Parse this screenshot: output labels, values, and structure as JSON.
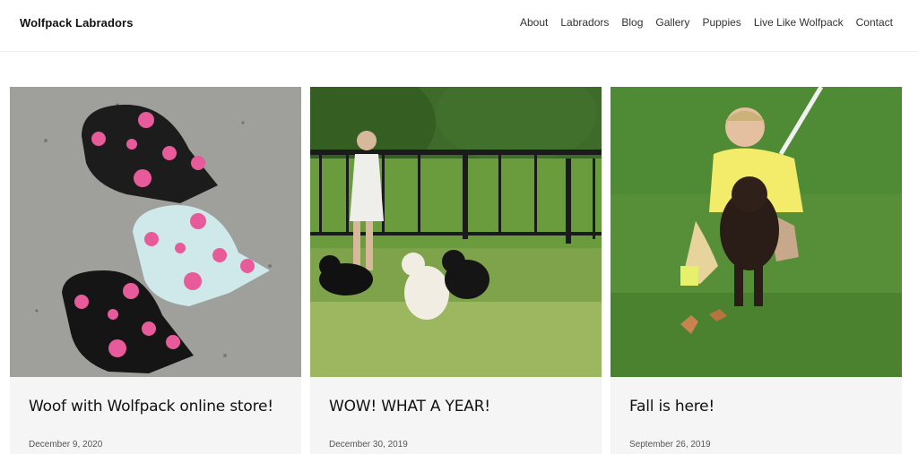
{
  "site": {
    "brand": "Wolfpack Labradors"
  },
  "nav": [
    {
      "label": "About"
    },
    {
      "label": "Labradors"
    },
    {
      "label": "Blog"
    },
    {
      "label": "Gallery"
    },
    {
      "label": "Puppies"
    },
    {
      "label": "Live Like Wolfpack"
    },
    {
      "label": "Contact"
    }
  ],
  "posts": [
    {
      "title": "Woof with Wolfpack online store!",
      "date": "December 9, 2020",
      "image": "labrador-head-stickers"
    },
    {
      "title": "WOW! WHAT A YEAR!",
      "date": "December 30, 2019",
      "image": "woman-with-three-labradors"
    },
    {
      "title": "Fall is here!",
      "date": "September 26, 2019",
      "image": "woman-hugging-chocolate-lab"
    }
  ]
}
